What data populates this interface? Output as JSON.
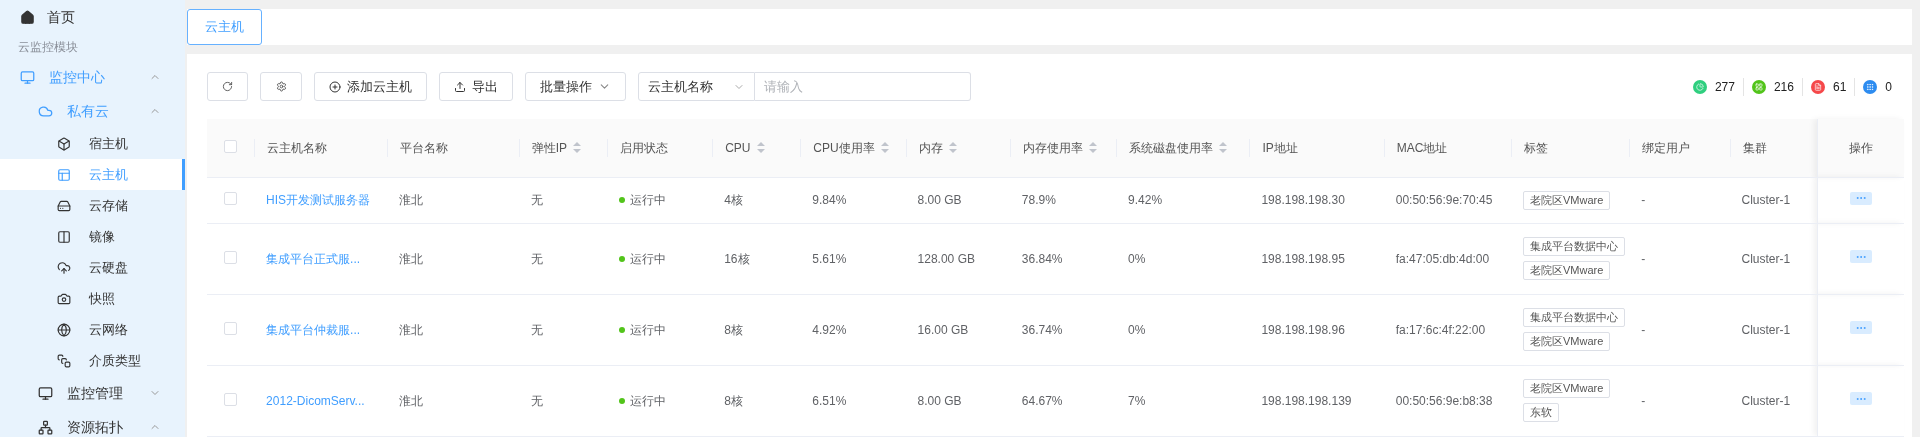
{
  "sidebar": {
    "items": [
      {
        "kind": "link",
        "label": "首页"
      },
      {
        "kind": "heading",
        "label": "云监控模块"
      },
      {
        "kind": "group",
        "label": "监控中心",
        "expanded": true,
        "children": [
          {
            "kind": "group",
            "label": "私有云",
            "expanded": true,
            "children": [
              {
                "kind": "link",
                "label": "宿主机",
                "selected": false
              },
              {
                "kind": "link",
                "label": "云主机",
                "selected": true
              },
              {
                "kind": "link",
                "label": "云存储",
                "selected": false
              },
              {
                "kind": "link",
                "label": "镜像",
                "selected": false
              },
              {
                "kind": "link",
                "label": "云硬盘",
                "selected": false
              },
              {
                "kind": "link",
                "label": "快照",
                "selected": false
              },
              {
                "kind": "link",
                "label": "云网络",
                "selected": false
              },
              {
                "kind": "link",
                "label": "介质类型",
                "selected": false
              }
            ]
          },
          {
            "kind": "group",
            "label": "监控管理",
            "expanded": false
          },
          {
            "kind": "group",
            "label": "资源拓扑",
            "expanded": true
          }
        ]
      }
    ]
  },
  "tabs": [
    {
      "label": "云主机",
      "selected": true
    }
  ],
  "toolbar": {
    "actions": [
      {
        "kind": "icon-button",
        "label": "添加云主机"
      },
      {
        "kind": "icon-button",
        "label": "导出"
      },
      {
        "kind": "dropdown",
        "label": "批量操作"
      }
    ],
    "search": {
      "field": "云主机名称",
      "placeholder": "请输入"
    }
  },
  "stats": [
    {
      "value": "277",
      "color": "#2fcf7f"
    },
    {
      "value": "216",
      "color": "#52c41a"
    },
    {
      "value": "61",
      "color": "#f5484a"
    },
    {
      "value": "0",
      "color": "#2d8cf0"
    }
  ],
  "table": {
    "select_all": {
      "checked": false
    },
    "columns": [
      {
        "label": "云主机名称",
        "sortable": false
      },
      {
        "label": "平台名称",
        "sortable": false
      },
      {
        "label": "弹性IP",
        "sortable": true
      },
      {
        "label": "启用状态",
        "sortable": false
      },
      {
        "label": "CPU",
        "sortable": true
      },
      {
        "label": "CPU使用率",
        "sortable": true
      },
      {
        "label": "内存",
        "sortable": true
      },
      {
        "label": "内存使用率",
        "sortable": true
      },
      {
        "label": "系统磁盘使用率",
        "sortable": true
      },
      {
        "label": "IP地址",
        "sortable": false
      },
      {
        "label": "MAC地址",
        "sortable": false
      },
      {
        "label": "标签",
        "sortable": false
      },
      {
        "label": "绑定用户",
        "sortable": false
      },
      {
        "label": "集群",
        "sortable": false
      },
      {
        "label": "操作",
        "sortable": false
      }
    ],
    "rows": [
      {
        "checked": false,
        "name": "HIS开发测试服务器",
        "platform": "淮北",
        "eip": "无",
        "status": {
          "label": "运行中",
          "color": "#52c41a"
        },
        "cpu": "4核",
        "cpu_usage": "9.84%",
        "memory": "8.00 GB",
        "memory_usage": "78.9%",
        "disk_usage": "9.42%",
        "ip": "198.198.198.30",
        "mac": "00:50:56:9e:70:45",
        "tags": [
          "老院区VMware"
        ],
        "user": "-",
        "cluster": "Cluster-1"
      },
      {
        "checked": false,
        "name": "集成平台正式服...",
        "platform": "淮北",
        "eip": "无",
        "status": {
          "label": "运行中",
          "color": "#52c41a"
        },
        "cpu": "16核",
        "cpu_usage": "5.61%",
        "memory": "128.00 GB",
        "memory_usage": "36.84%",
        "disk_usage": "0%",
        "ip": "198.198.198.95",
        "mac": "fa:47:05:db:4d:00",
        "tags": [
          "集成平台数据中心",
          "老院区VMware"
        ],
        "user": "-",
        "cluster": "Cluster-1"
      },
      {
        "checked": false,
        "name": "集成平台仲裁服...",
        "platform": "淮北",
        "eip": "无",
        "status": {
          "label": "运行中",
          "color": "#52c41a"
        },
        "cpu": "8核",
        "cpu_usage": "4.92%",
        "memory": "16.00 GB",
        "memory_usage": "36.74%",
        "disk_usage": "0%",
        "ip": "198.198.198.96",
        "mac": "fa:17:6c:4f:22:00",
        "tags": [
          "集成平台数据中心",
          "老院区VMware"
        ],
        "user": "-",
        "cluster": "Cluster-1"
      },
      {
        "checked": false,
        "name": "2012-DicomServ...",
        "platform": "淮北",
        "eip": "无",
        "status": {
          "label": "运行中",
          "color": "#52c41a"
        },
        "cpu": "8核",
        "cpu_usage": "6.51%",
        "memory": "8.00 GB",
        "memory_usage": "64.67%",
        "disk_usage": "7%",
        "ip": "198.198.198.139",
        "mac": "00:50:56:9e:b8:38",
        "tags": [
          "老院区VMware",
          "东软"
        ],
        "user": "-",
        "cluster": "Cluster-1"
      }
    ]
  }
}
